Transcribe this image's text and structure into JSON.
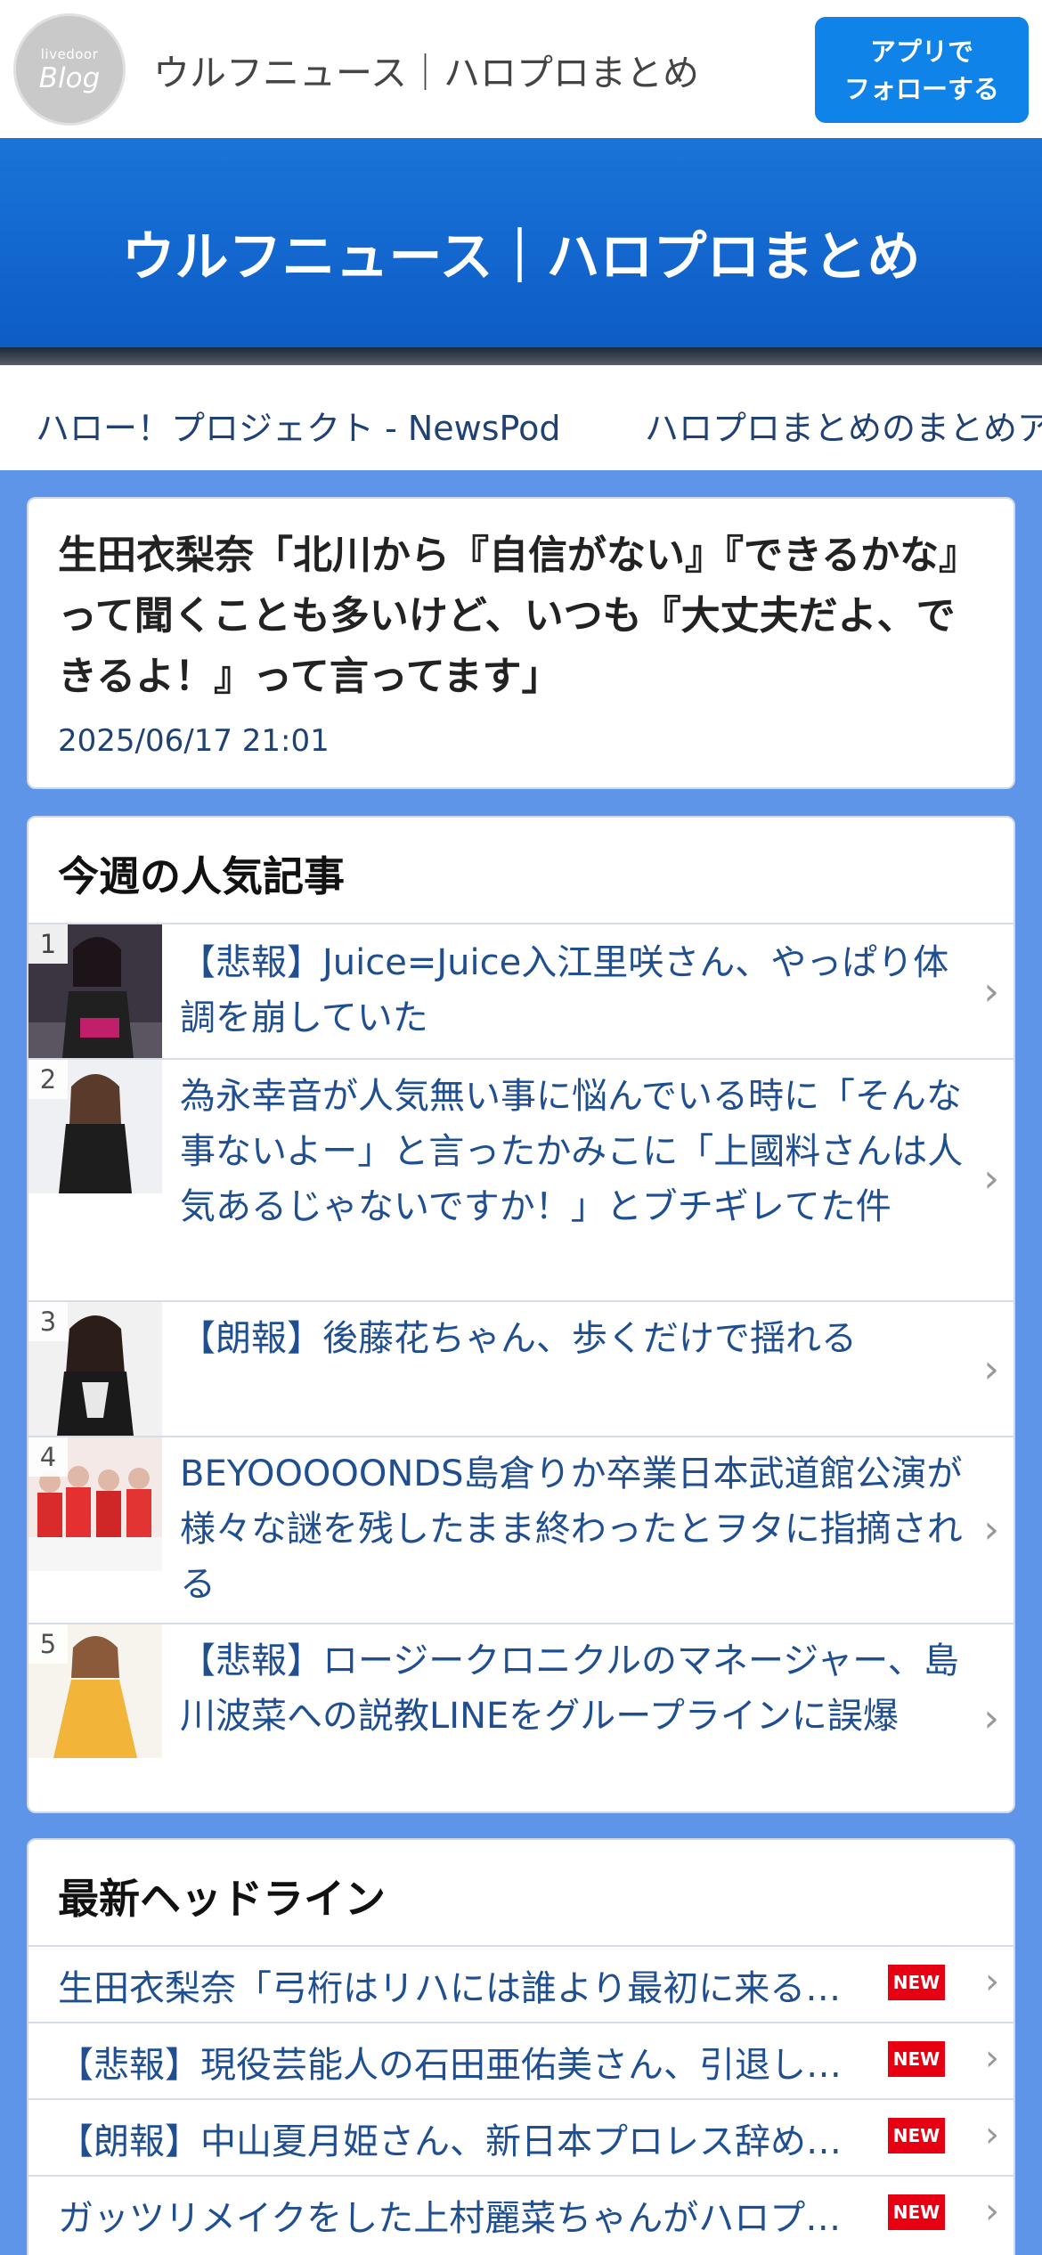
{
  "app": {
    "logo_small": "livedoor",
    "logo_big": "Blog",
    "header_title": "ウルフニュース｜ハロプロまとめ",
    "follow_button": [
      "アプリで",
      "フォローする"
    ],
    "hero_title": "ウルフニュース｜ハロプロまとめ"
  },
  "links": [
    "ハロー！プロジェクト - NewsPod",
    "ハロプロまとめのまとめア"
  ],
  "article": {
    "title": "生田衣梨奈「北川から『自信がない』『できるかな』って聞くことも多いけど、いつも『大丈夫だよ、できるよ！』って言ってます」",
    "date": "2025/06/17 21:01"
  },
  "ranking": {
    "title": "今週の人気記事",
    "items": [
      {
        "rank": "1",
        "title": "【悲報】Juice=Juice入江里咲さん、やっぱり体調を崩していた"
      },
      {
        "rank": "2",
        "title": "為永幸音が人気無い事に悩んでいる時に「そんな事ないよー」と言ったかみこに「上國料さんは人気あるじゃないですか！」とブチギレてた件"
      },
      {
        "rank": "3",
        "title": "【朗報】後藤花ちゃん、歩くだけで揺れる"
      },
      {
        "rank": "4",
        "title": "BEYOOOOONDS島倉りか卒業日本武道館公演が様々な謎を残したまま終わったとヲタに指摘される"
      },
      {
        "rank": "5",
        "title": "【悲報】ロージークロニクルのマネージャー、島川波菜への説教LINEをグループラインに誤爆"
      }
    ]
  },
  "headlines": {
    "title": "最新ヘッドライン",
    "new_label": "NEW",
    "items": [
      "生田衣梨奈「弓桁はリハには誰より最初に来る…",
      "【悲報】現役芸能人の石田亜佑美さん、引退し…",
      "【朗報】中山夏月姫さん、新日本プロレス辞め…",
      "ガッツリメイクをした上村麗菜ちゃんがハロプ…"
    ]
  },
  "icons": {
    "chevron": "chevron-right-icon"
  },
  "colors": {
    "accent": "#0f83e8",
    "background": "#5f95e8",
    "link": "#1f4f91",
    "new_badge": "#e60012"
  }
}
